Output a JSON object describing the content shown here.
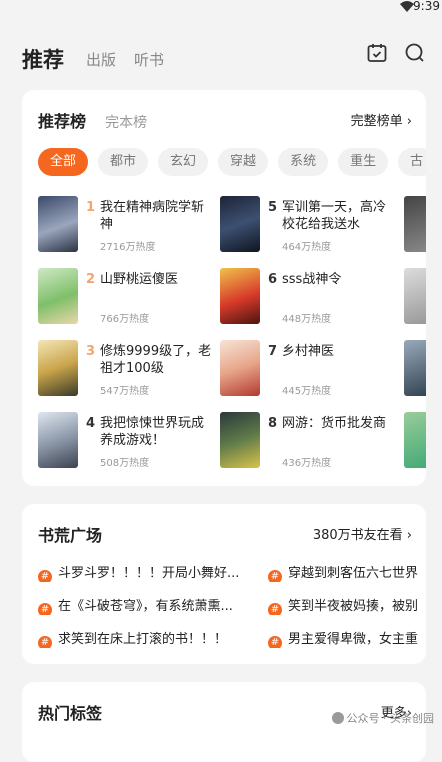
{
  "status": {
    "time": "9:39"
  },
  "nav": {
    "tabs": [
      "推荐",
      "出版",
      "听书"
    ]
  },
  "ranking": {
    "title": "推荐榜",
    "alt": "完本榜",
    "more": "完整榜单 ›",
    "categories": [
      "全部",
      "都市",
      "玄幻",
      "穿越",
      "系统",
      "重生",
      "古"
    ],
    "books": [
      {
        "rank": "1",
        "title": "我在精神病院学斩神",
        "heat": "2716万热度"
      },
      {
        "rank": "2",
        "title": "山野桃运傻医",
        "heat": "766万热度"
      },
      {
        "rank": "3",
        "title": "修炼9999级了，老祖才100级",
        "heat": "547万热度"
      },
      {
        "rank": "4",
        "title": "我把惊悚世界玩成养成游戏！",
        "heat": "508万热度"
      },
      {
        "rank": "5",
        "title": "军训第一天，高冷校花给我送水",
        "heat": "464万热度"
      },
      {
        "rank": "6",
        "title": "sss战神令",
        "heat": "448万热度"
      },
      {
        "rank": "7",
        "title": "乡村神医",
        "heat": "445万热度"
      },
      {
        "rank": "8",
        "title": "网游：货币批发商",
        "heat": "436万热度"
      }
    ]
  },
  "square": {
    "title": "书荒广场",
    "more": "380万书友在看 ›",
    "posts": [
      "斗罗斗罗！！！！开局小舞好...",
      "在《斗破苍穹》，有系统萧熏...",
      "求笑到在床上打滚的书！！！",
      "穿越到刺客伍六七世界",
      "笑到半夜被妈揍，被别",
      "男主爱得卑微，女主重"
    ]
  },
  "tags": {
    "title": "热门标签",
    "more": "更多›"
  },
  "watermark": "公众号 · 头条创园",
  "colors": {
    "accent": "#f5661f",
    "rank_top": "#f5a56b",
    "rank_other": "#333333"
  }
}
